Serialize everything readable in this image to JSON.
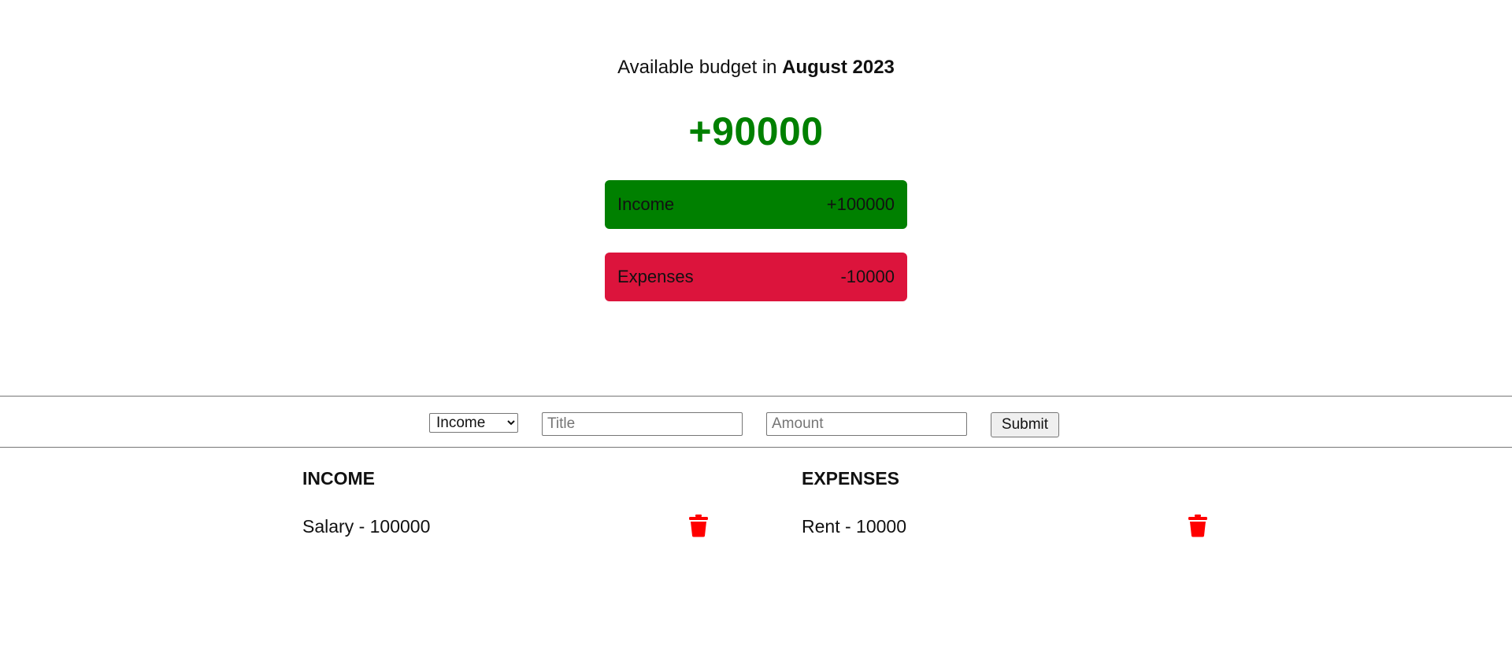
{
  "budget": {
    "label": "Available budget in",
    "month": "August 2023",
    "value": "+90000"
  },
  "summary": {
    "income": {
      "label": "Income",
      "value": "+100000"
    },
    "expenses": {
      "label": "Expenses",
      "value": "-10000"
    }
  },
  "form": {
    "type_selected": "Income",
    "title_placeholder": "Title",
    "amount_placeholder": "Amount",
    "submit_label": "Submit"
  },
  "lists": {
    "income": {
      "heading": "INCOME",
      "items": [
        {
          "text": "Salary - 100000",
          "icon": "trash-icon"
        }
      ]
    },
    "expenses": {
      "heading": "EXPENSES",
      "items": [
        {
          "text": "Rent - 10000",
          "icon": "trash-icon"
        }
      ]
    }
  },
  "colors": {
    "positive": "#008000",
    "income_card": "#008000",
    "expenses_card": "#dc143c",
    "delete_icon": "#ff0000"
  }
}
